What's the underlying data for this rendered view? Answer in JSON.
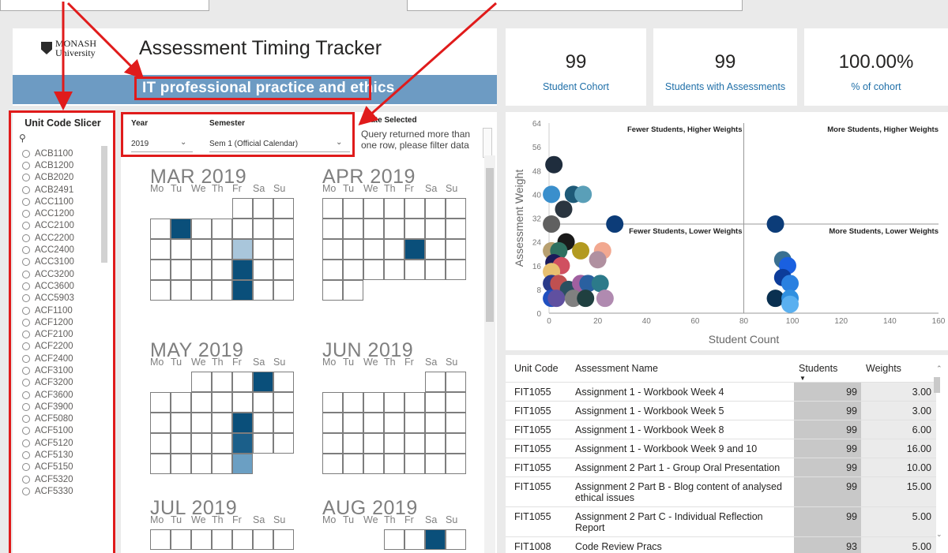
{
  "header": {
    "logo": {
      "line1": "MONASH",
      "line2": "University"
    },
    "title": "Assessment Timing Tracker",
    "unit_title": "IT professional practice and ethics"
  },
  "kpis": [
    {
      "value": "99",
      "label": "Student Cohort"
    },
    {
      "value": "99",
      "label": "Students with Assessments"
    },
    {
      "value": "100.00%",
      "label": "% of cohort"
    }
  ],
  "slicer": {
    "title": "Unit Code Slicer",
    "items": [
      "ACB1100",
      "ACB1200",
      "ACB2020",
      "ACB2491",
      "ACC1100",
      "ACC1200",
      "ACC2100",
      "ACC2200",
      "ACC2400",
      "ACC3100",
      "ACC3200",
      "ACC3600",
      "ACC5903",
      "ACF1100",
      "ACF1200",
      "ACF2100",
      "ACF2200",
      "ACF2400",
      "ACF3100",
      "ACF3200",
      "ACF3600",
      "ACF3900",
      "ACF5080",
      "ACF5100",
      "ACF5120",
      "ACF5130",
      "ACF5150",
      "ACF5320",
      "ACF5330"
    ]
  },
  "filters": {
    "year_label": "Year",
    "year_value": "2019",
    "semester_label": "Semester",
    "semester_value": "Sem 1 (Official Calendar)",
    "date_label": "Date Selected",
    "date_message": "Query returned more than one row, please filter data"
  },
  "calendar": {
    "weekday_header": [
      "Mo",
      "Tu",
      "We",
      "Th",
      "Fr",
      "Sa",
      "Su"
    ],
    "months": [
      {
        "label": "MAR 2019",
        "offset": 4,
        "days": 31,
        "highlights": {
          "5": "#0a4f7a",
          "15": "#a9c6db",
          "22": "#0a4f7a",
          "29": "#0a4f7a"
        }
      },
      {
        "label": "APR 2019",
        "offset": 0,
        "days": 30,
        "highlights": {
          "19": "#0a4f7a"
        }
      },
      {
        "label": "MAY 2019",
        "offset": 2,
        "days": 31,
        "highlights": {
          "4": "#0a4f7a",
          "17": "#0a4f7a",
          "24": "#1b5f8a",
          "31": "#6b9fc3"
        }
      },
      {
        "label": "JUN 2019",
        "offset": 5,
        "days": 30,
        "highlights": {}
      },
      {
        "label": "JUL 2019",
        "offset": 0,
        "days": 31,
        "highlights": {}
      },
      {
        "label": "AUG 2019",
        "offset": 3,
        "days": 31,
        "highlights": {
          "3": "#0a4f7a"
        }
      }
    ]
  },
  "chart_data": {
    "type": "scatter",
    "xlabel": "Student Count",
    "ylabel": "Assessment Weight",
    "xlim": [
      0,
      160
    ],
    "ylim": [
      0,
      64
    ],
    "xticks": [
      0,
      20,
      40,
      60,
      80,
      100,
      120,
      140,
      160
    ],
    "yticks": [
      0,
      8,
      16,
      24,
      32,
      40,
      48,
      56,
      64
    ],
    "reference_lines": {
      "x": 80,
      "y": 30
    },
    "quadrant_labels": {
      "top_left": "Fewer Students, Higher Weights",
      "top_right": "More Students, Higher Weights",
      "bottom_left": "Fewer Students, Lower Weights",
      "bottom_right": "More Students, Lower Weights"
    },
    "points": [
      {
        "x": 2,
        "y": 50,
        "c": "#1f2d3d"
      },
      {
        "x": 1,
        "y": 40,
        "c": "#3a8fcc"
      },
      {
        "x": 10,
        "y": 40,
        "c": "#1e5a78"
      },
      {
        "x": 14,
        "y": 40,
        "c": "#5a9fb8"
      },
      {
        "x": 6,
        "y": 35,
        "c": "#2a3540"
      },
      {
        "x": 1,
        "y": 30,
        "c": "#606060"
      },
      {
        "x": 27,
        "y": 30,
        "c": "#0c3c78"
      },
      {
        "x": 93,
        "y": 30,
        "c": "#0c3c78"
      },
      {
        "x": 7,
        "y": 24,
        "c": "#1a1a1a"
      },
      {
        "x": 1,
        "y": 21,
        "c": "#b8a070"
      },
      {
        "x": 4,
        "y": 21,
        "c": "#2e7060"
      },
      {
        "x": 13,
        "y": 21,
        "c": "#b39a20"
      },
      {
        "x": 22,
        "y": 21,
        "c": "#f2a890"
      },
      {
        "x": 20,
        "y": 18,
        "c": "#b090a0"
      },
      {
        "x": 96,
        "y": 18,
        "c": "#3a7090"
      },
      {
        "x": 98,
        "y": 16,
        "c": "#1a60e0"
      },
      {
        "x": 2,
        "y": 17,
        "c": "#1a1a5a"
      },
      {
        "x": 5,
        "y": 16,
        "c": "#d05060"
      },
      {
        "x": 1,
        "y": 14,
        "c": "#e8c070"
      },
      {
        "x": 96,
        "y": 12,
        "c": "#0c3c9a"
      },
      {
        "x": 99,
        "y": 10,
        "c": "#2a80e0"
      },
      {
        "x": 1,
        "y": 10,
        "c": "#2a3a8a"
      },
      {
        "x": 4,
        "y": 10,
        "c": "#c05050"
      },
      {
        "x": 8,
        "y": 8,
        "c": "#2a5060"
      },
      {
        "x": 13,
        "y": 10,
        "c": "#a060a0"
      },
      {
        "x": 16,
        "y": 10,
        "c": "#2a60a0"
      },
      {
        "x": 21,
        "y": 10,
        "c": "#2c7a8a"
      },
      {
        "x": 1,
        "y": 5,
        "c": "#2050c0"
      },
      {
        "x": 3,
        "y": 5,
        "c": "#6050a0"
      },
      {
        "x": 10,
        "y": 5,
        "c": "#808080"
      },
      {
        "x": 15,
        "y": 5,
        "c": "#204040"
      },
      {
        "x": 23,
        "y": 5,
        "c": "#b08ab0"
      },
      {
        "x": 93,
        "y": 5,
        "c": "#0a3050"
      },
      {
        "x": 99,
        "y": 5,
        "c": "#3090e0"
      },
      {
        "x": 99,
        "y": 3,
        "c": "#5ab0f0"
      }
    ]
  },
  "table": {
    "columns": [
      "Unit Code",
      "Assessment Name",
      "Students",
      "Weights"
    ],
    "rows": [
      {
        "unit": "FIT1055",
        "name": "Assignment 1 - Workbook Week 4",
        "students": "99",
        "weight": "3.00"
      },
      {
        "unit": "FIT1055",
        "name": "Assignment 1 - Workbook Week 5",
        "students": "99",
        "weight": "3.00"
      },
      {
        "unit": "FIT1055",
        "name": "Assignment 1 - Workbook Week 8",
        "students": "99",
        "weight": "6.00"
      },
      {
        "unit": "FIT1055",
        "name": "Assignment 1 - Workbook Week 9 and 10",
        "students": "99",
        "weight": "16.00"
      },
      {
        "unit": "FIT1055",
        "name": "Assignment 2 Part 1 - Group Oral Presentation",
        "students": "99",
        "weight": "10.00"
      },
      {
        "unit": "FIT1055",
        "name": "Assignment 2 Part B - Blog content of analysed ethical issues",
        "students": "99",
        "weight": "15.00"
      },
      {
        "unit": "FIT1055",
        "name": "Assignment 2 Part C - Individual Reflection Report",
        "students": "99",
        "weight": "5.00"
      },
      {
        "unit": "FIT1008",
        "name": "Code Review Pracs",
        "students": "93",
        "weight": "5.00"
      }
    ]
  },
  "colors": {
    "banner": "#6d9bc3",
    "accent": "#1f6fa8",
    "highlight_dark": "#0a4f7a",
    "annotation": "#e01b1b"
  }
}
